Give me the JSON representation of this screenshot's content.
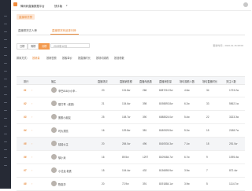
{
  "topbar": {
    "app_name": "蝉妈妈直播数据平台",
    "switch_label": "快手版"
  },
  "breadcrumb": {
    "label": "直播带货榜"
  },
  "tabs": [
    {
      "label": "直播带货达人榜"
    },
    {
      "label": "直播带货商品排行榜"
    }
  ],
  "filters": {
    "buttons": [
      {
        "label": "日榜"
      },
      {
        "label": "周榜"
      },
      {
        "label": "月榜"
      }
    ],
    "date_value": "2019年12月",
    "update_text": "更新时间：2020-01-15 08:00"
  },
  "sort": {
    "label": "排序方式：",
    "options": [
      {
        "label": "按销量"
      },
      {
        "label": "按销售额"
      },
      {
        "label": "按客单价"
      },
      {
        "label": "按直播时长"
      },
      {
        "label": "按场均观看"
      },
      {
        "label": "按涨粉数"
      }
    ]
  },
  "table": {
    "columns": [
      "排行",
      "播主",
      "直播场次",
      "直播销售额",
      "直播商品数",
      "直播销售量",
      "场均观看人数",
      "场均直播时长",
      "关注人数"
    ],
    "rows": [
      {
        "rank": "01",
        "name": "辛巴818小小辛…",
        "col1": "20",
        "col2": "131.8w",
        "col3": "266",
        "col4": "8287210.9w",
        "col5": "4.6w",
        "col6": "34",
        "col7": "1723.2w"
      },
      {
        "rank": "02",
        "name": "散打哥（老铁）",
        "col1": "21",
        "col2": "134.6w",
        "col3": "398",
        "col4": "8198893.8w",
        "col5": "6.2w",
        "col6": "33",
        "col7": "5562.1w"
      },
      {
        "rank": "03",
        "name": "蛋蛋小朋友",
        "col1": "25",
        "col2": "108.7w",
        "col3": "390",
        "col4": "6088524.0w",
        "col5": "5.4w",
        "col6": "22",
        "col7": "3323.3w"
      },
      {
        "rank": "04",
        "name": "时大漂亮",
        "col1": "16",
        "col2": "129.8w",
        "col3": "381",
        "col4": "8180525.5w",
        "col5": "5.2w",
        "col6": "15",
        "col7": "2188.7w"
      },
      {
        "rank": "05",
        "name": "娃娃公主",
        "col1": "20",
        "col2": "284.0w",
        "col3": "496",
        "col4": "8160534.3w",
        "col5": "7.1w",
        "col6": "18",
        "col7": "251.0w"
      },
      {
        "rank": "06",
        "name": "徐小米",
        "col1": "16",
        "col2": "89.5w",
        "col3": "1297",
        "col4": "8109484.7w",
        "col5": "6.7w",
        "col6": "9",
        "col7": "1095.4w"
      },
      {
        "rank": "07",
        "name": "小沈龙 老铁",
        "col1": "15",
        "col2": "104.4w",
        "col3": "432",
        "col4": "8136855.9w",
        "col5": "3.9w",
        "col6": "7",
        "col7": "872.4w"
      },
      {
        "rank": "08",
        "name": "陈晓华",
        "col1": "20",
        "col2": "72.9w",
        "col3": "391",
        "col4": "8191884.1w",
        "col5": "3.9w",
        "col6": "5",
        "col7": "1114.7w"
      }
    ]
  },
  "colors": {
    "accent": "#f39a4e",
    "sidebar": "#262a35"
  }
}
